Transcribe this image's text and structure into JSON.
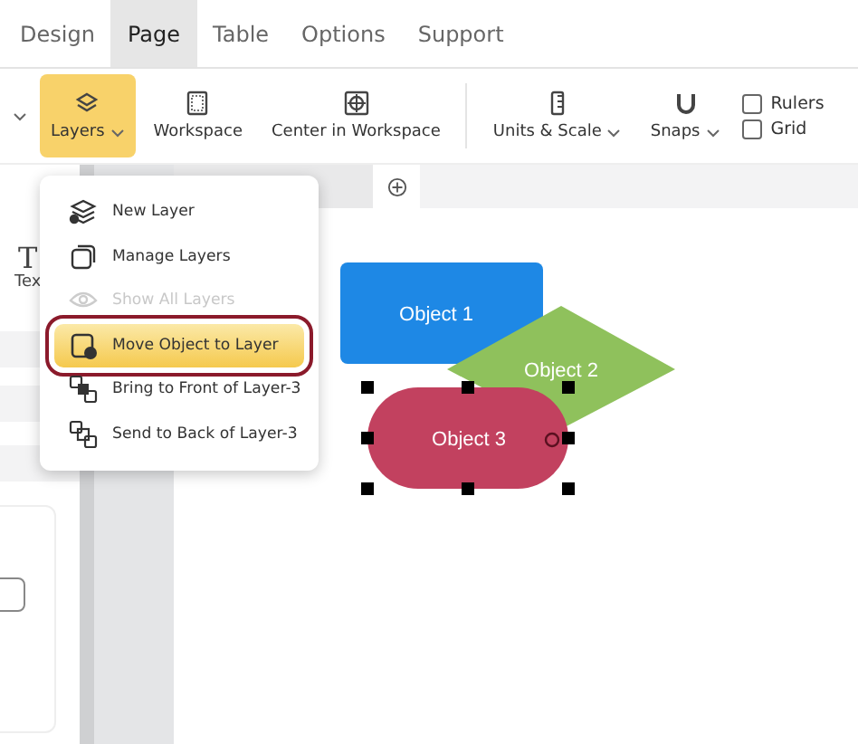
{
  "tabs": [
    {
      "label": "Design",
      "selected": false
    },
    {
      "label": "Page",
      "selected": true
    },
    {
      "label": "Table",
      "selected": false
    },
    {
      "label": "Options",
      "selected": false
    },
    {
      "label": "Support",
      "selected": false
    }
  ],
  "toolbar": {
    "groups": [
      [
        {
          "label": "Layers",
          "dropdown": true,
          "selected": true
        },
        {
          "label": "Workspace",
          "dropdown": false,
          "selected": false
        },
        {
          "label": "Center in Workspace",
          "dropdown": false,
          "selected": false
        }
      ],
      [
        {
          "label": "Units & Scale",
          "dropdown": true,
          "selected": false
        },
        {
          "label": "Snaps",
          "dropdown": true,
          "selected": false
        }
      ]
    ],
    "checkboxes": [
      {
        "label": "Rulers",
        "checked": false
      },
      {
        "label": "Grid",
        "checked": false
      }
    ]
  },
  "left_panel": {
    "tool_icon": "T",
    "tool_label": "Tex"
  },
  "menu": {
    "items": [
      {
        "label": "New Layer",
        "disabled": false,
        "selected": false
      },
      {
        "label": "Manage Layers",
        "disabled": false,
        "selected": false
      },
      {
        "label": "Show All Layers",
        "disabled": true,
        "selected": false
      },
      {
        "label": "Move Object to Layer",
        "disabled": false,
        "selected": true
      },
      {
        "label": "Bring to Front of Layer-3",
        "disabled": false,
        "selected": false
      },
      {
        "label": "Send to Back of Layer-3",
        "disabled": false,
        "selected": false
      }
    ]
  },
  "canvas": {
    "objects": [
      {
        "label": "Object 1",
        "kind": "rect",
        "color": "#1e88e5",
        "selected": false
      },
      {
        "label": "Object 2",
        "kind": "diamond",
        "color": "#8fc15c",
        "selected": false
      },
      {
        "label": "Object 3",
        "kind": "pill",
        "color": "#c2415f",
        "selected": true
      }
    ]
  }
}
